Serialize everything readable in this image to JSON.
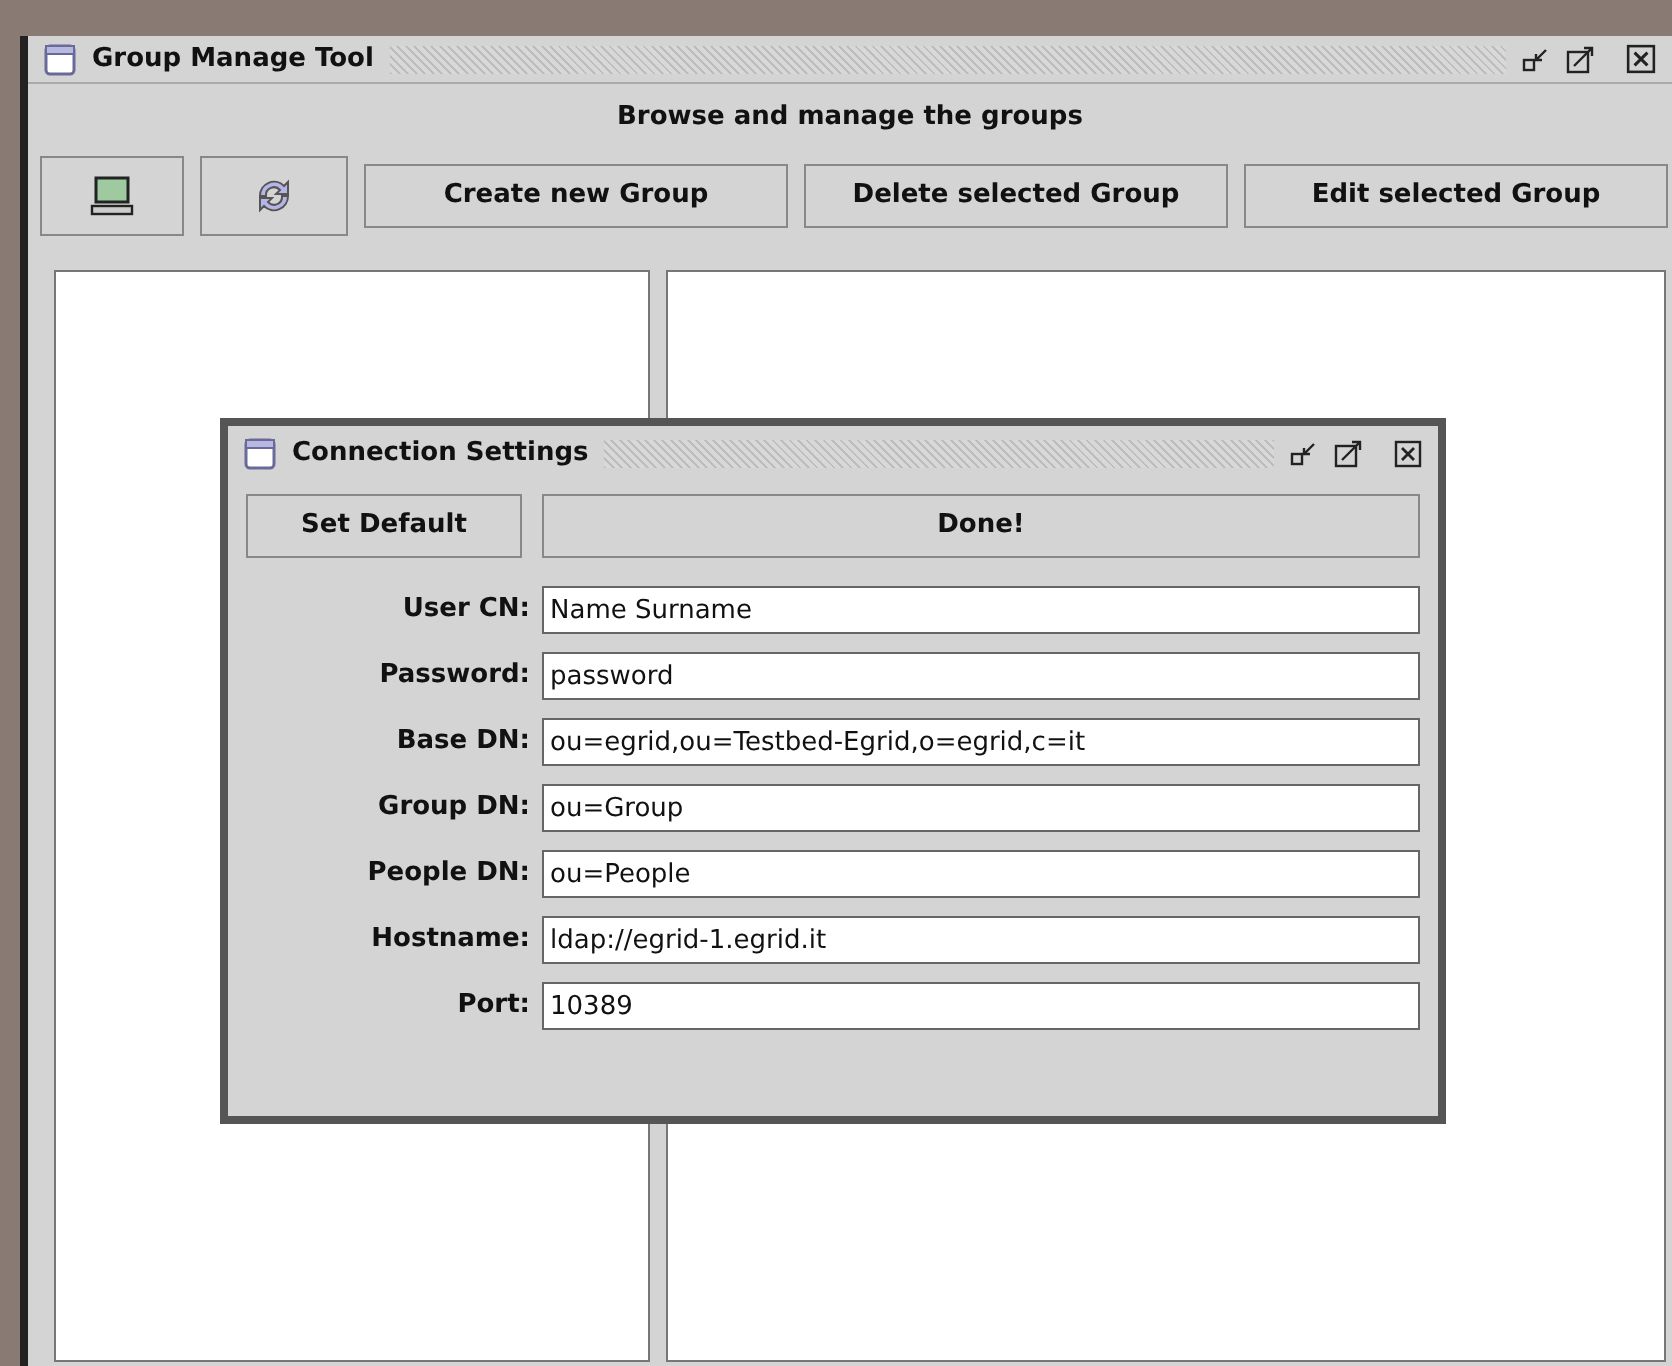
{
  "window": {
    "title": "Group Manage Tool"
  },
  "header": "Browse and manage the groups",
  "toolbar": {
    "buttons": [
      "Create new Group",
      "Delete selected Group",
      "Edit selected Group"
    ]
  },
  "dialog": {
    "title": "Connection Settings",
    "buttons": [
      "Set Default",
      "Done!"
    ],
    "fields": [
      {
        "label": "User CN:",
        "value": "Name Surname"
      },
      {
        "label": "Password:",
        "value": "password"
      },
      {
        "label": "Base DN:",
        "value": "ou=egrid,ou=Testbed-Egrid,o=egrid,c=it"
      },
      {
        "label": "Group DN:",
        "value": "ou=Group"
      },
      {
        "label": "People DN:",
        "value": "ou=People"
      },
      {
        "label": "Hostname:",
        "value": "ldap://egrid-1.egrid.it"
      },
      {
        "label": "Port:",
        "value": "10389"
      }
    ]
  }
}
